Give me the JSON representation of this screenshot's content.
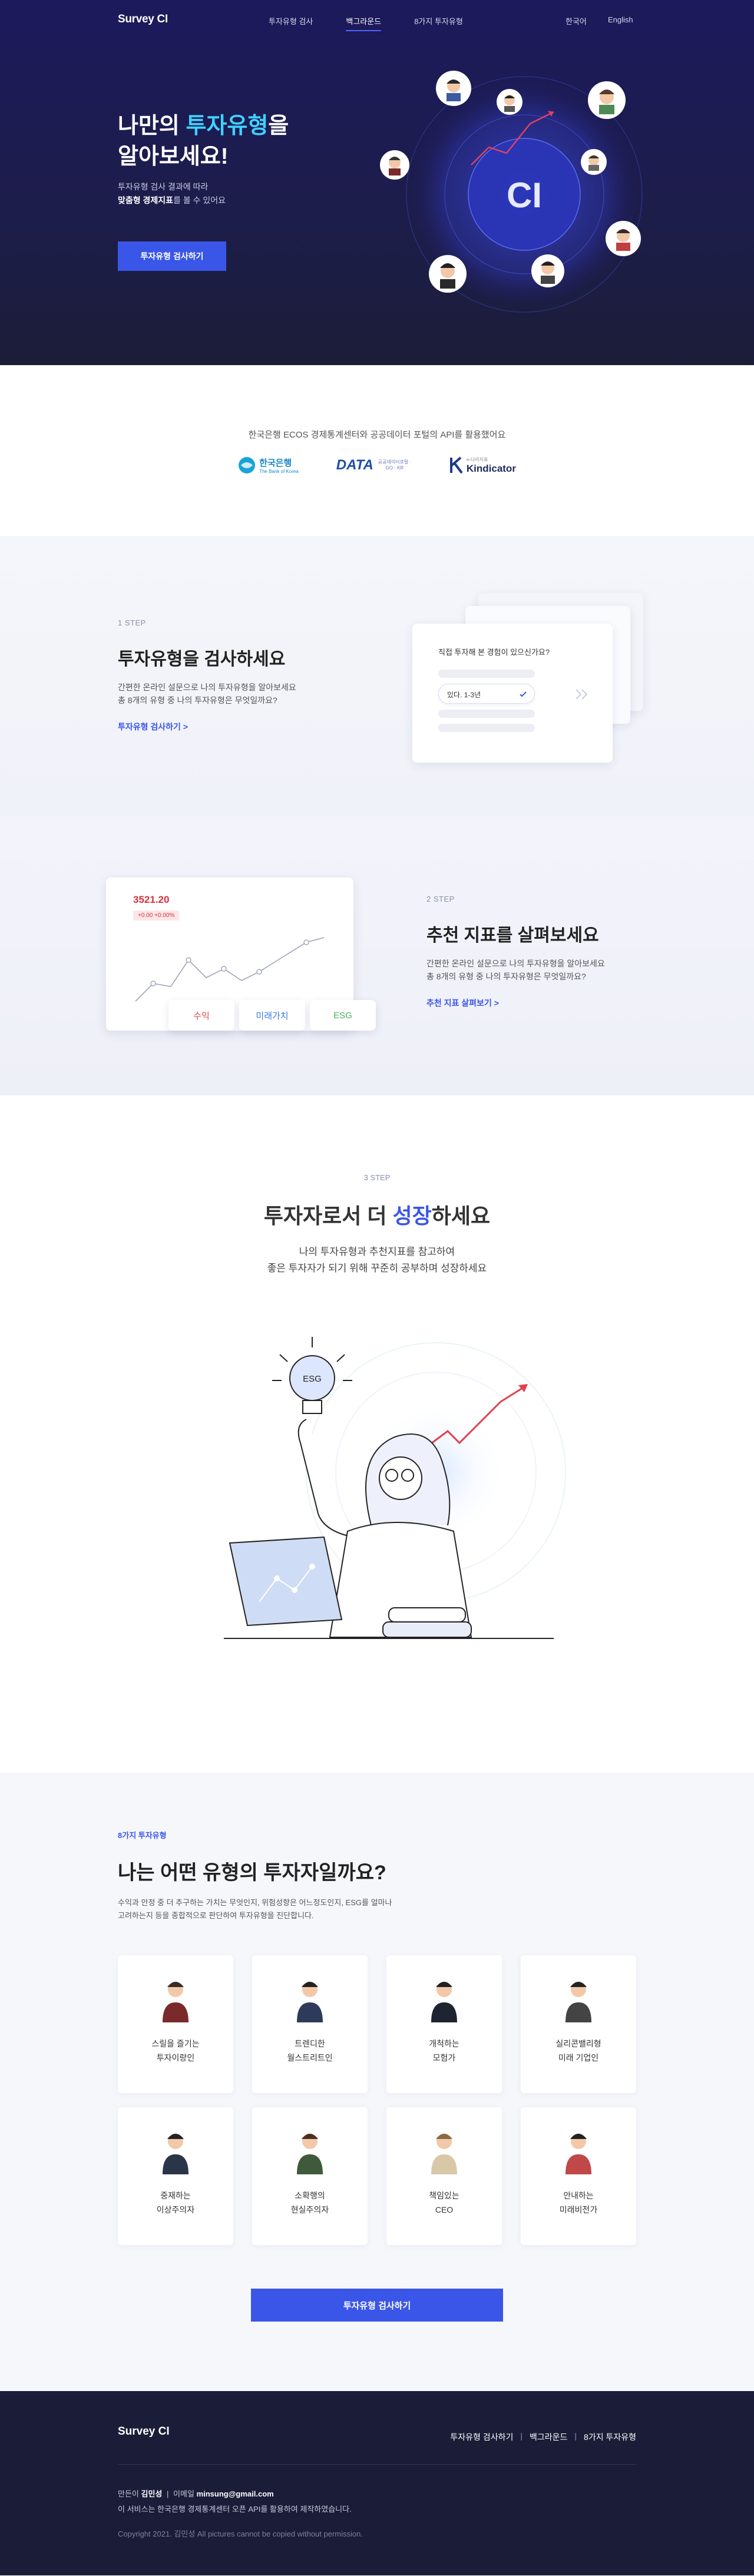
{
  "nav": {
    "logo": "Survey CI",
    "links": [
      "투자유형 검사",
      "백그라운드",
      "8가지 투자유형"
    ],
    "lang_ko": "한국어",
    "lang_en": "English"
  },
  "hero": {
    "title_pre": "나만의 ",
    "title_hl": "투자유형",
    "title_post": "을",
    "title_line2": "알아보세요!",
    "sub_line1": "투자유형 검사 결과에 따라",
    "sub_bold": "맞춤형 경제지표",
    "sub_line2_rest": "를 볼 수 있어요",
    "button": "투자유형 검사하기",
    "center_text": "CI"
  },
  "partners": {
    "text": "한국은행 ECOS 경제통계센터와 공공데이터 포털의 API를 활용했어요",
    "logos": [
      {
        "name": "한국은행",
        "sub": "The Bank of Korea"
      },
      {
        "name": "DATA",
        "sub": "공공데이터포털 · GO · KR"
      },
      {
        "name": "Kindicator",
        "sub": "e-나라지표"
      }
    ]
  },
  "step1": {
    "label": "1 STEP",
    "title": "투자유형을 검사하세요",
    "desc_line1": "간편한 온라인 설문으로 나의 투자유형을 알아보세요",
    "desc_line2": "총 8개의 유형 중 나의 투자유형은 무엇일까요?",
    "link": "투자유형 검사하기 >",
    "card_question": "직접 투자해 본 경험이 있으신가요?",
    "card_option": "있다. 1-3년"
  },
  "step2": {
    "label": "2 STEP",
    "title": "추천 지표를 살펴보세요",
    "desc_line1": "간편한 온라인 설문으로 나의 투자유형을 알아보세요",
    "desc_line2": "총 8개의 유형 중 나의 투자유형은 무엇일까요?",
    "link": "추천 지표 살펴보기 >",
    "chart_value": "3521.20",
    "chart_change": "+0.00 +0.00%",
    "chips": [
      "수익",
      "미래가치",
      "ESG"
    ]
  },
  "step3": {
    "label": "3 STEP",
    "title_pre": "투자자로서 더 ",
    "title_hl": "성장",
    "title_post": "하세요",
    "desc_line1": "나의 투자유형과 추천지표를 참고하여",
    "desc_line2": "좋은 투자자가 되기 위해 꾸준히 공부하며 성장하세요",
    "bulb_text": "ESG"
  },
  "types": {
    "label": "8가지 투자유형",
    "title": "나는 어떤 유형의 투자자일까요?",
    "desc_line1": "수익과 안정 중 더 추구하는 가치는 무엇인지, 위험성향은 어느정도인지, ESG를 얼마나",
    "desc_line2": "고려하는지 등을 종합적으로 판단하여 투자유형을 진단합니다.",
    "items": [
      "스릴을 즐기는\n투자이랑인",
      "트렌디한\n월스트리트인",
      "개척하는\n모험가",
      "실리콘밸리형\n미래 기업인",
      "중재하는\n이상주의자",
      "소확행의\n현실주의자",
      "책임있는\nCEO",
      "안내하는\n미래비전가"
    ],
    "button": "투자유형 검사하기"
  },
  "footer": {
    "logo": "Survey CI",
    "links": [
      "투자유형 검사하기",
      "백그라운드",
      "8가지 투자유형"
    ],
    "maker_label": "만든이",
    "maker_name": "김민성",
    "email_label": "이메일",
    "email": "minsung@gmail.com",
    "notice": "이 서비스는 한국은행 경제통계센터 오픈 API를 활용하여 제작하였습니다.",
    "copyright": "Copyright 2021. 김민성 All pictures cannot be copied without permission."
  },
  "colors": {
    "accent": "#3a56e8",
    "highlight": "#3fd1ff",
    "hero_bg": "#1c1a5c",
    "footer_bg": "#1b1d38"
  }
}
